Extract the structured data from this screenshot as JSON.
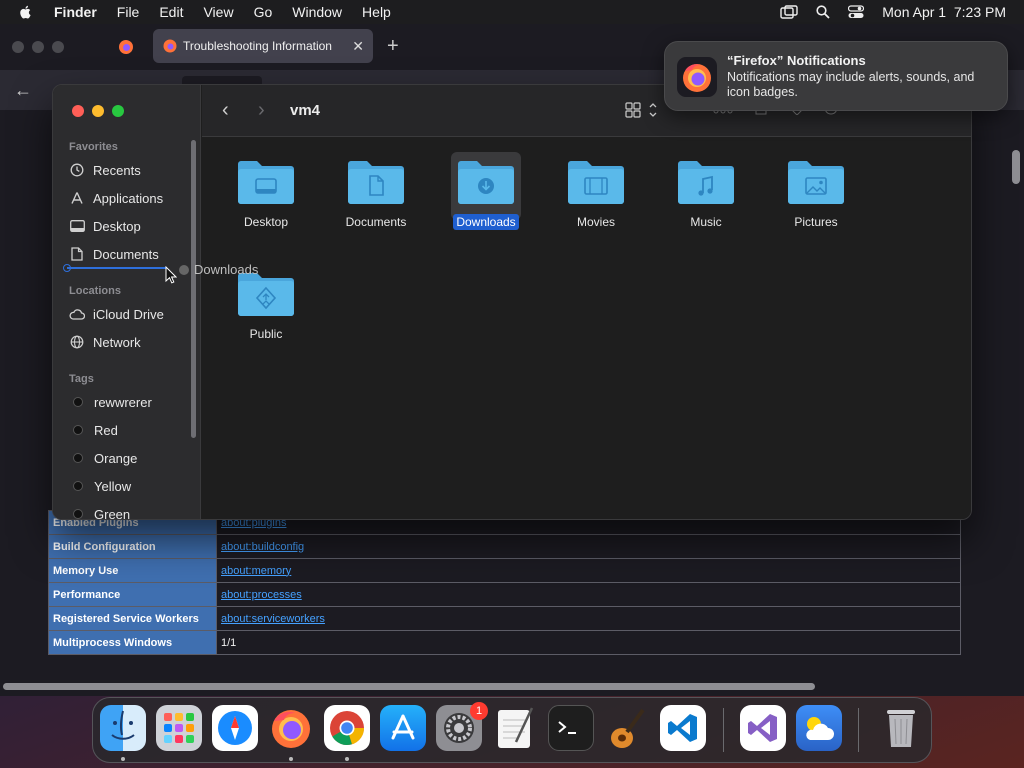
{
  "menubar": {
    "app_name": "Finder",
    "items": [
      "File",
      "Edit",
      "View",
      "Go",
      "Window",
      "Help"
    ],
    "datetime": "Mon Apr 1  7:23 PM"
  },
  "firefox": {
    "tab_title": "Troubleshooting Information",
    "table": [
      {
        "key": "Enabled Plugins",
        "value": "about:plugins",
        "link": true
      },
      {
        "key": "Build Configuration",
        "value": "about:buildconfig",
        "link": true
      },
      {
        "key": "Memory Use",
        "value": "about:memory",
        "link": true
      },
      {
        "key": "Performance",
        "value": "about:processes",
        "link": true
      },
      {
        "key": "Registered Service Workers",
        "value": "about:serviceworkers",
        "link": true
      },
      {
        "key": "Multiprocess Windows",
        "value": "1/1",
        "link": false
      }
    ]
  },
  "finder": {
    "title": "vm4",
    "sidebar": {
      "favorites_label": "Favorites",
      "favorites": [
        "Recents",
        "Applications",
        "Desktop",
        "Documents"
      ],
      "drag_label": "Downloads",
      "locations_label": "Locations",
      "locations": [
        "iCloud Drive",
        "Network"
      ],
      "tags_label": "Tags",
      "tags": [
        "rewwrerer",
        "Red",
        "Orange",
        "Yellow",
        "Green"
      ]
    },
    "folders": [
      {
        "name": "Desktop",
        "icon": "desktop",
        "selected": false
      },
      {
        "name": "Documents",
        "icon": "document",
        "selected": false
      },
      {
        "name": "Downloads",
        "icon": "download",
        "selected": true
      },
      {
        "name": "Movies",
        "icon": "film",
        "selected": false
      },
      {
        "name": "Music",
        "icon": "music",
        "selected": false
      },
      {
        "name": "Pictures",
        "icon": "picture",
        "selected": false
      },
      {
        "name": "Public",
        "icon": "public",
        "selected": false
      }
    ]
  },
  "notification": {
    "title": "“Firefox” Notifications",
    "body": "Notifications may include alerts, sounds, and icon badges."
  },
  "dock": {
    "system_settings_badge": "1"
  },
  "colors": {
    "selection": "#1f5fd0",
    "folder": "#5ab9ea",
    "link": "#45a1ff"
  }
}
